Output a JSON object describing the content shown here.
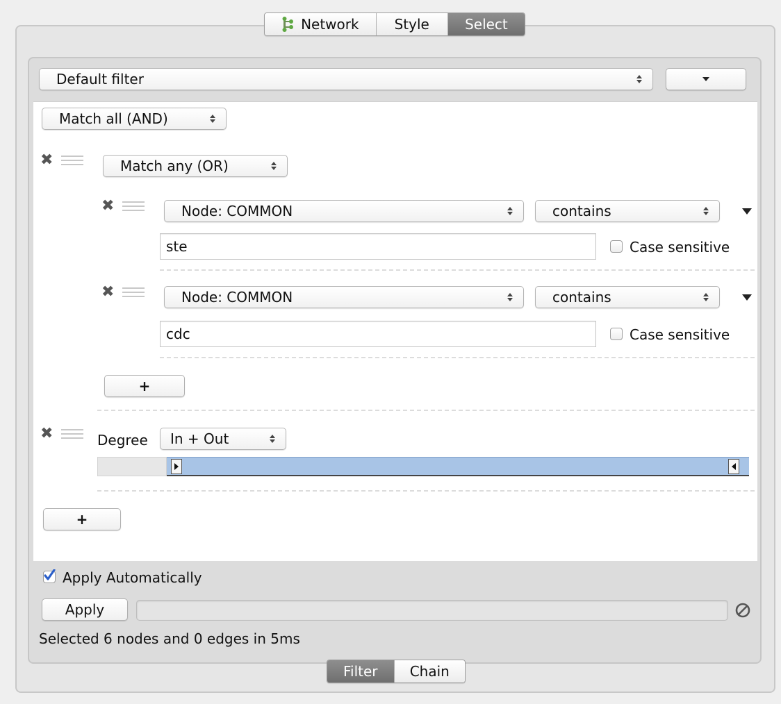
{
  "top_tabs": [
    {
      "label": "Network",
      "icon": "network-tree-icon",
      "selected": false
    },
    {
      "label": "Style",
      "selected": false
    },
    {
      "label": "Select",
      "selected": true
    }
  ],
  "filter_select": {
    "value": "Default filter"
  },
  "menu_button": {
    "icon": "chevron-down-icon"
  },
  "root_match": {
    "value": "Match all (AND)"
  },
  "group": {
    "match": "Match any (OR)",
    "conditions": [
      {
        "column": "Node: COMMON",
        "operator": "contains",
        "text": "ste",
        "case_label": "Case sensitive",
        "case_checked": false
      },
      {
        "column": "Node: COMMON",
        "operator": "contains",
        "text": "cdc",
        "case_label": "Case sensitive",
        "case_checked": false
      }
    ],
    "add_label": "+"
  },
  "degree": {
    "label": "Degree",
    "mode": "In + Out",
    "range_low_fraction": 0.0,
    "range_high_fraction": 1.0
  },
  "add_label": "+",
  "apply_automatically": {
    "label": "Apply Automatically",
    "checked": true
  },
  "apply_button": "Apply",
  "status": "Selected 6 nodes and 0 edges in 5ms",
  "cancel_icon": "cancel-circle-icon",
  "bottom_tabs": [
    {
      "label": "Filter",
      "selected": true
    },
    {
      "label": "Chain",
      "selected": false
    }
  ],
  "colors": {
    "selected_tab": "#7a7a7a",
    "range_fill": "#a8c4e6",
    "check_blue": "#2b5fc9"
  }
}
